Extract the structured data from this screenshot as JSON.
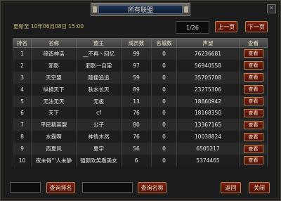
{
  "window": {
    "title": "所有联盟",
    "close_icon": "✕"
  },
  "header": {
    "updated_text": "更新至 10年06月08日 15:00",
    "page_indicator": "1/26",
    "prev_label": "上一页",
    "next_label": "下一页"
  },
  "table": {
    "columns": [
      "排名",
      "名称",
      "盟主",
      "成员数",
      "名城数",
      "声望",
      "查看"
    ],
    "view_label": "查看",
    "rows": [
      {
        "rank": "1",
        "name": "缔造神话",
        "leader": "__不再丶回忆",
        "members": "99",
        "cities": "0",
        "prestige": "76236681"
      },
      {
        "rank": "2",
        "name": "邪影",
        "leader": "邪影一自棠",
        "members": "97",
        "cities": "0",
        "prestige": "56940558"
      },
      {
        "rank": "3",
        "name": "天空盟",
        "leader": "随便追追",
        "members": "59",
        "cities": "0",
        "prestige": "35705708"
      },
      {
        "rank": "4",
        "name": "纵横天下",
        "leader": "秋水长天",
        "members": "89",
        "cities": "0",
        "prestige": "23275306"
      },
      {
        "rank": "5",
        "name": "无法无天",
        "leader": "无极",
        "members": "13",
        "cities": "0",
        "prestige": "18660942"
      },
      {
        "rank": "6",
        "name": "天下",
        "leader": "cf",
        "members": "76",
        "cities": "0",
        "prestige": "18168350"
      },
      {
        "rank": "7",
        "name": "平民精英盟",
        "leader": "公子",
        "members": "80",
        "cities": "0",
        "prestige": "13367165"
      },
      {
        "rank": "8",
        "name": "水霸啊",
        "leader": "神情木然",
        "members": "76",
        "cities": "0",
        "prestige": "10038824"
      },
      {
        "rank": "9",
        "name": "西夏风",
        "leader": "夏宇",
        "members": "56",
        "cities": "0",
        "prestige": "6505217"
      },
      {
        "rank": "10",
        "name": "夜未得'''人未静",
        "leader": "强颜欢笑看美女",
        "members": "6",
        "cities": "0",
        "prestige": "5374465"
      }
    ]
  },
  "footer": {
    "search_rank_label": "查询排名",
    "search_name_label": "查询名称",
    "back_label": "返回",
    "close_label": "关闭",
    "rank_input_value": "",
    "name_input_value": ""
  }
}
